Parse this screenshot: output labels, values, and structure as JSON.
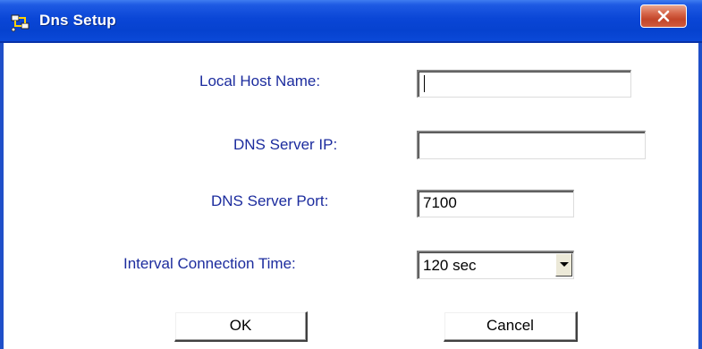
{
  "window": {
    "title": "Dns Setup",
    "app_icon": "network-setup-icon",
    "close_icon": "close-icon"
  },
  "form": {
    "local_host_name": {
      "label": "Local Host Name:",
      "value": ""
    },
    "dns_server_ip": {
      "label": "DNS Server IP:",
      "value": ""
    },
    "dns_server_port": {
      "label": "DNS Server Port:",
      "value": "7100"
    },
    "interval_connection_time": {
      "label": "Interval Connection Time:",
      "selected": "120 sec"
    }
  },
  "buttons": {
    "ok": "OK",
    "cancel": "Cancel"
  },
  "colors": {
    "titlebar": "#0a46d6",
    "label_text": "#1c2c9e",
    "close_button": "#c3462a"
  }
}
